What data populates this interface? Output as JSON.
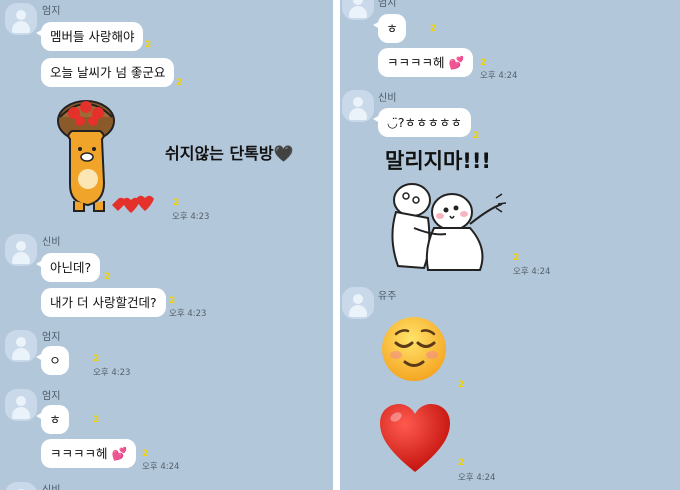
{
  "left_panel": {
    "first_sender": "엄지",
    "messages_1": [
      "멤버들 사랑해야",
      "오늘 날씨가 넘 좋군요"
    ],
    "unread_1": [
      "2",
      "2"
    ],
    "big_text": "쉬지않는  단톡방🖤",
    "unread_sticker": "2",
    "time_1": "오후 4:23",
    "sender_2": "신비",
    "messages_2": [
      "아닌데?",
      "내가 더 사랑할건데?"
    ],
    "unread_2": [
      "2",
      "2"
    ],
    "time_2": "오후 4:23",
    "sender_3": "엄지",
    "message_3": "ㅇ",
    "unread_3": "2",
    "time_3": "오후 4:23",
    "sender_4": "엄지",
    "message_4a": "ㅎ",
    "unread_4a": "2",
    "message_4b": "ㅋㅋㅋㅋ헤",
    "unread_4b": "2",
    "time_4": "오후 4:24",
    "sender_5": "신비"
  },
  "right_panel": {
    "sender_1": "엄지",
    "message_1a": "ㅎ",
    "unread_1a": "2",
    "message_1b": "ㅋㅋㅋㅋ헤",
    "unread_1b": "2",
    "time_1": "오후 4:24",
    "sender_2": "신비",
    "message_2": "◡̈?ㅎㅎㅎㅎㅎ",
    "unread_2": "2",
    "big_text": "말리지마!!!",
    "unread_sticker": "2",
    "time_2": "오후 4:24",
    "sender_3": "유주",
    "unread_emoji": "2",
    "unread_heart": "2",
    "time_3": "오후 4:24"
  },
  "icons": {
    "avatar": "default-profile-icon",
    "emoji": "relieved-face-emoji",
    "heart": "red-heart-emoji",
    "sparkle_heart": "two-hearts-icon"
  },
  "colors": {
    "chat_background": "#b2c7d9",
    "unread_badge": "#f5d200",
    "bubble": "#ffffff"
  }
}
